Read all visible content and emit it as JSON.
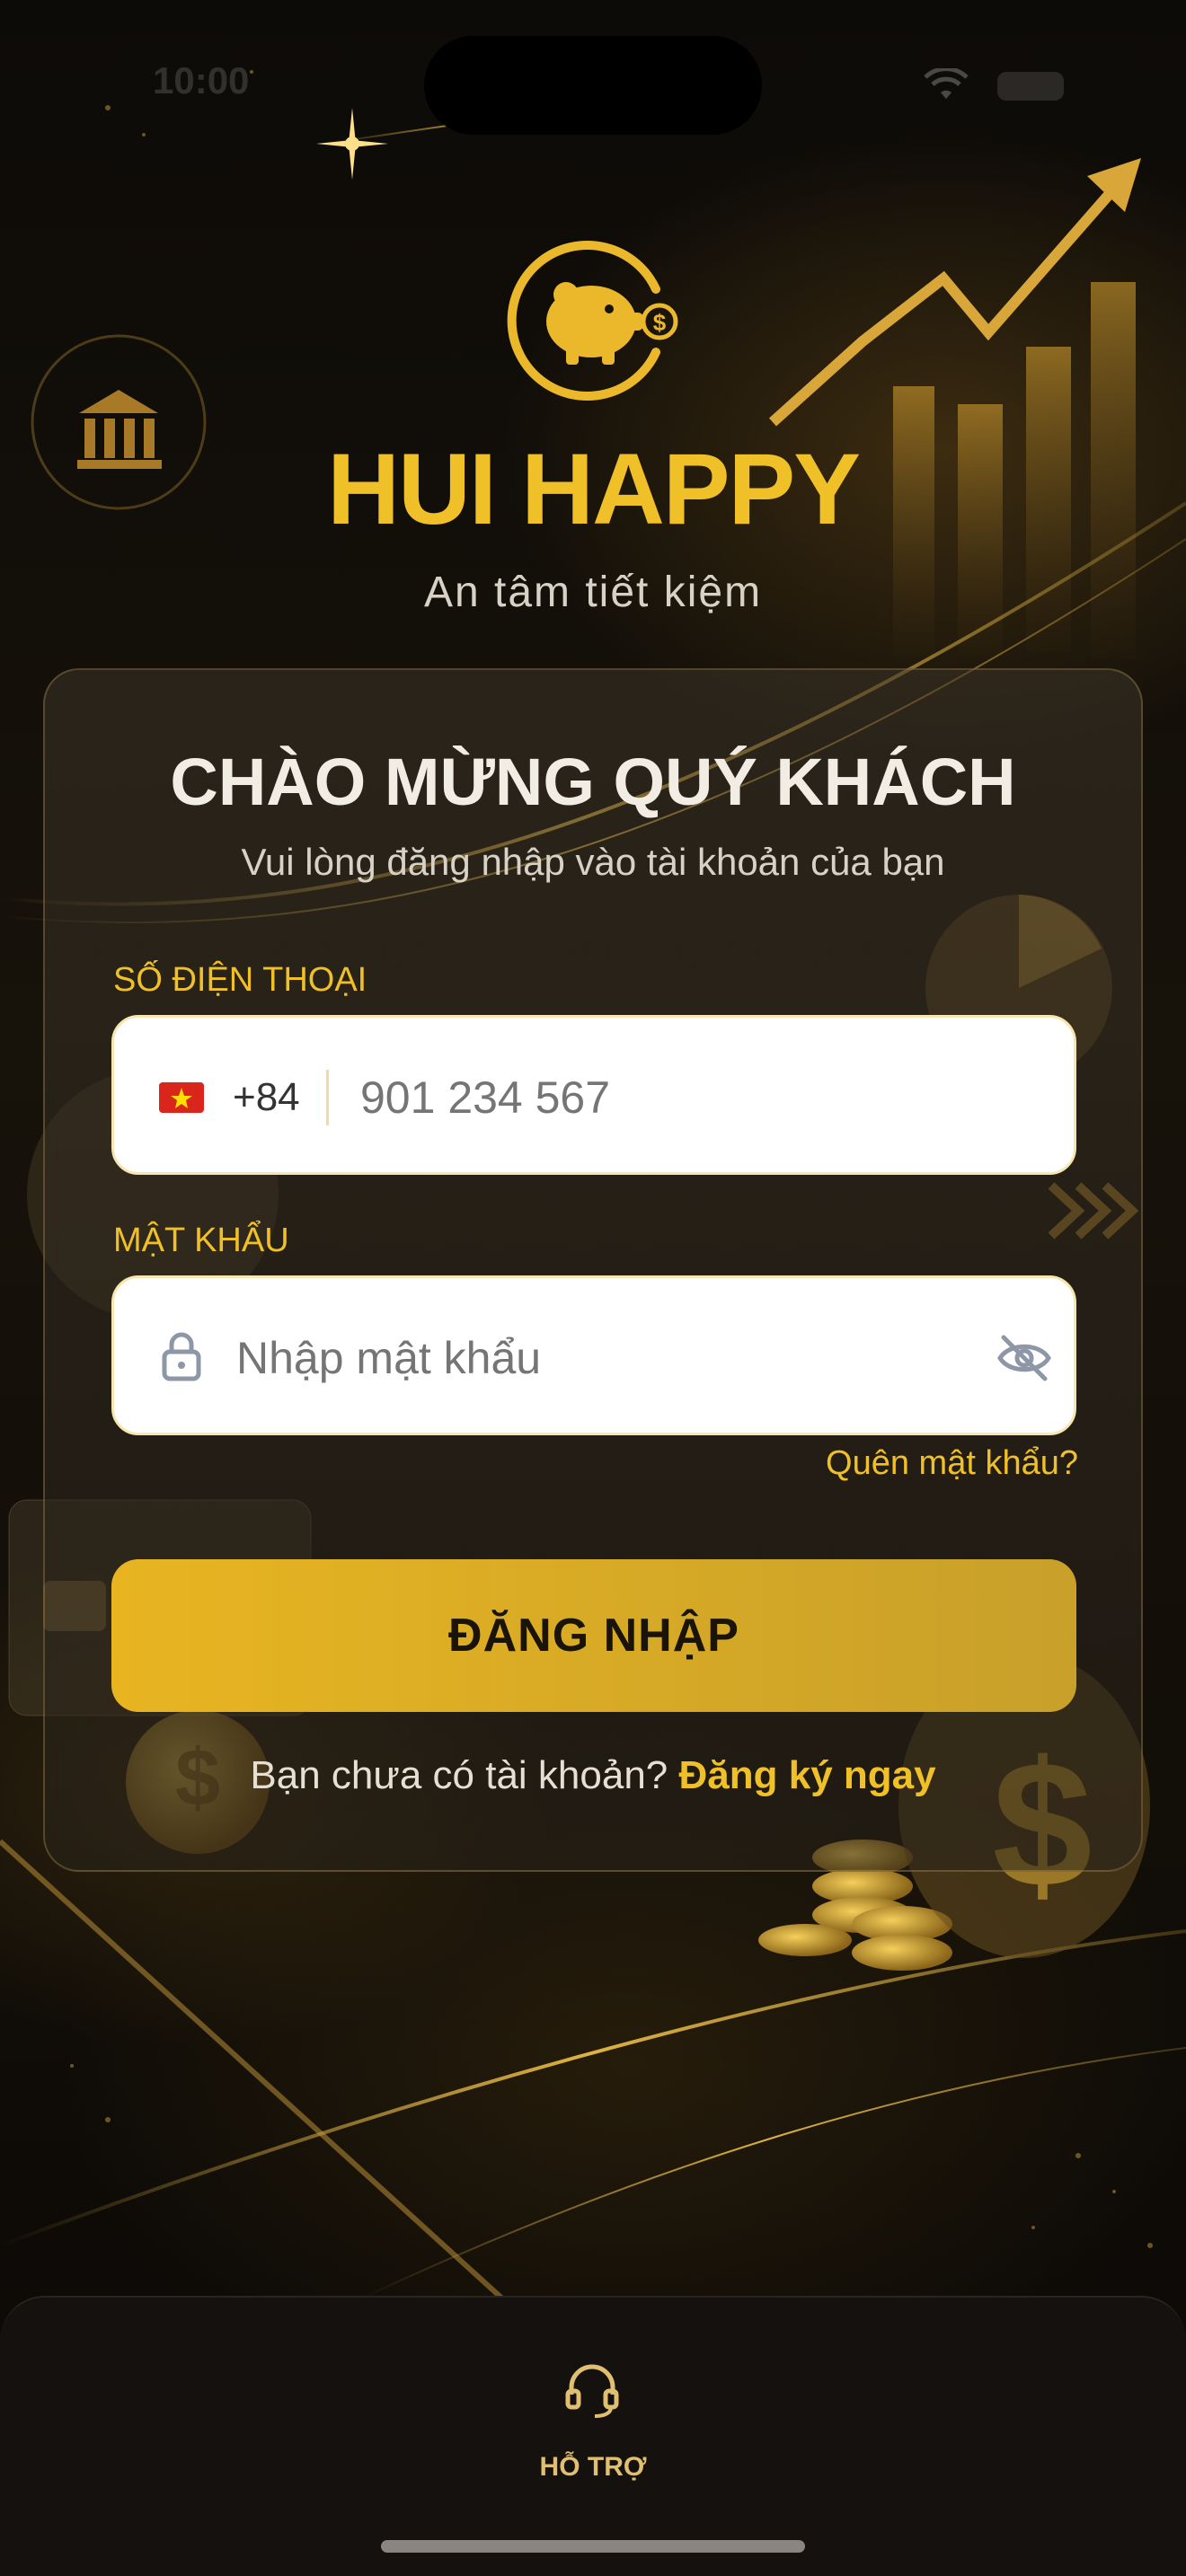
{
  "status_bar": {
    "time": "10:00"
  },
  "brand": {
    "app_name": "HUI HAPPY",
    "tagline": "An tâm tiết kiệm",
    "accent_color": "#f0c028"
  },
  "login_card": {
    "title": "CHÀO MỪNG QUÝ KHÁCH",
    "subtitle": "Vui lòng đăng nhập vào tài khoản của bạn",
    "phone": {
      "label": "SỐ ĐIỆN THOẠI",
      "country_code": "+84",
      "flag_icon": "vietnam-flag-icon",
      "placeholder": "901 234 567"
    },
    "password": {
      "label": "MẬT KHẨU",
      "placeholder": "Nhập mật khẩu",
      "lock_icon": "lock-icon",
      "toggle_icon": "eye-off-icon"
    },
    "forgot_password": "Quên mật khẩu?",
    "login_button": "ĐĂNG NHẬP",
    "signup_prompt": "Bạn chưa có tài khoản?",
    "signup_link": "Đăng ký ngay"
  },
  "bottom_nav": {
    "support_icon": "headset-icon",
    "support_label": "HỖ TRỢ"
  }
}
